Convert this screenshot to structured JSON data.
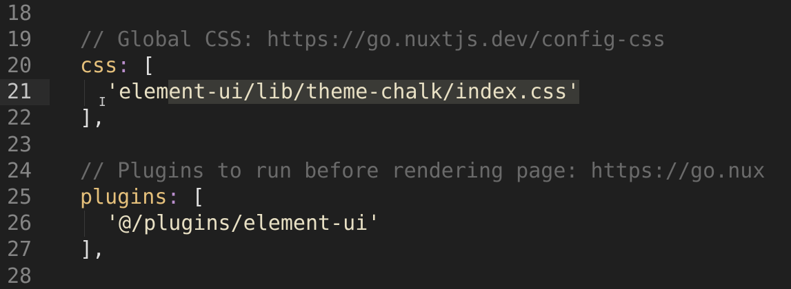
{
  "editor": {
    "lines": [
      {
        "num": "18",
        "parts": []
      },
      {
        "num": "19",
        "parts": [
          {
            "t": "// Global CSS: https://go.nuxtjs.dev/config-css",
            "c": "comment"
          }
        ]
      },
      {
        "num": "20",
        "parts": [
          {
            "t": "css",
            "c": "key"
          },
          {
            "t": ":",
            "c": "punct"
          },
          {
            "t": " [",
            "c": "bracket"
          }
        ]
      },
      {
        "num": "21",
        "parts": [
          {
            "t": "'",
            "c": "str"
          },
          {
            "t": "element-ui/lib/theme-chalk/index.css",
            "c": "str"
          },
          {
            "t": "'",
            "c": "str"
          }
        ]
      },
      {
        "num": "22",
        "parts": [
          {
            "t": "],",
            "c": "bracket"
          }
        ]
      },
      {
        "num": "23",
        "parts": []
      },
      {
        "num": "24",
        "parts": [
          {
            "t": "// Plugins to run before rendering page: https://go.nux",
            "c": "comment"
          }
        ]
      },
      {
        "num": "25",
        "parts": [
          {
            "t": "plugins",
            "c": "key"
          },
          {
            "t": ":",
            "c": "punct"
          },
          {
            "t": " [",
            "c": "bracket"
          }
        ]
      },
      {
        "num": "26",
        "parts": [
          {
            "t": "'@/plugins/element-ui'",
            "c": "str"
          }
        ]
      },
      {
        "num": "27",
        "parts": [
          {
            "t": "],",
            "c": "bracket"
          }
        ]
      },
      {
        "num": "28",
        "parts": []
      }
    ],
    "active_line": "21",
    "colors": {
      "background": "#1f1f1f",
      "line_number": "#858585",
      "comment": "#6a6a6a",
      "key": "#e5c07b",
      "punct": "#bb8fce",
      "string": "#e8e0c4",
      "selection": "#3a3a36"
    }
  }
}
